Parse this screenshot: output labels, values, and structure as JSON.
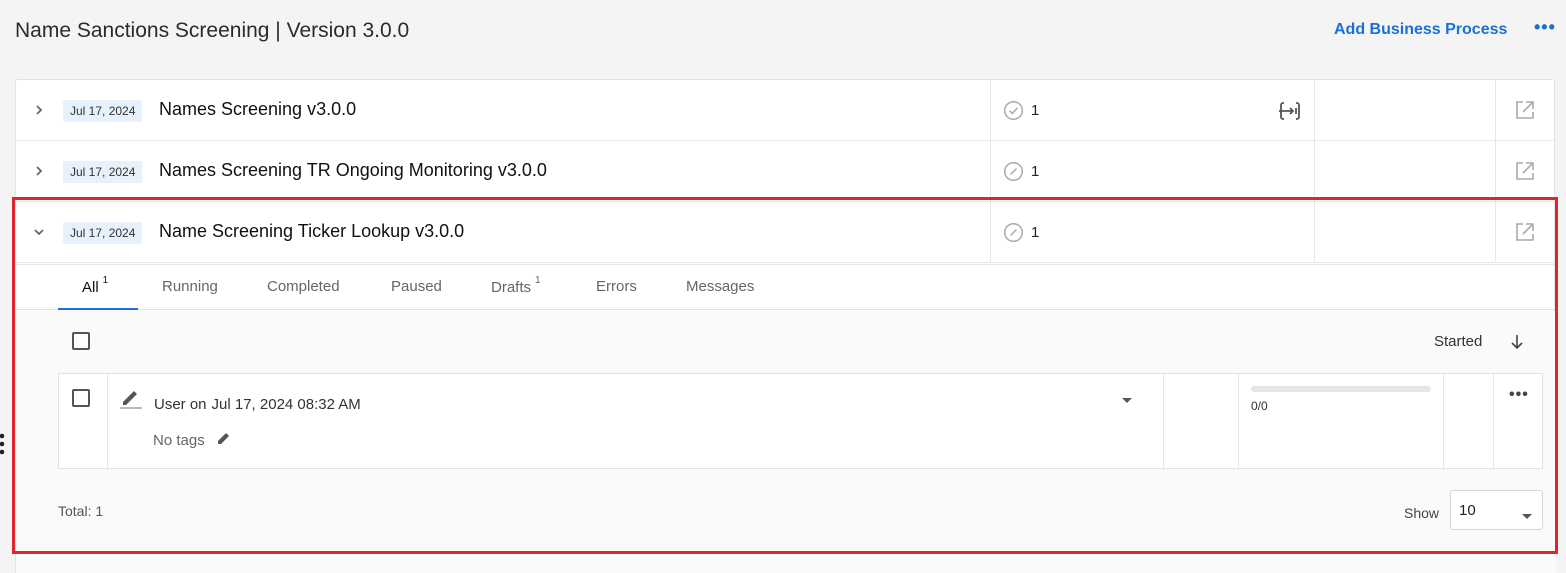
{
  "header": {
    "title": "Name Sanctions Screening | Version 3.0.0",
    "add_label": "Add Business Process",
    "more_label": "•••"
  },
  "processes": [
    {
      "date": "Jul 17, 2024",
      "name": "Names Screening v3.0.0",
      "count": "1",
      "expanded": false,
      "status_icon": "check-circle-icon",
      "has_transfer": true
    },
    {
      "date": "Jul 17, 2024",
      "name": "Names Screening TR Ongoing Monitoring v3.0.0",
      "count": "1",
      "expanded": false,
      "status_icon": "slash-circle-icon",
      "has_transfer": false
    },
    {
      "date": "Jul 17, 2024",
      "name": "Name Screening Ticker Lookup v3.0.0",
      "count": "1",
      "expanded": true,
      "status_icon": "slash-circle-icon",
      "has_transfer": false
    }
  ],
  "tabs": [
    {
      "label": "All",
      "badge": "1",
      "active": true
    },
    {
      "label": "Running",
      "badge": ""
    },
    {
      "label": "Completed",
      "badge": ""
    },
    {
      "label": "Paused",
      "badge": ""
    },
    {
      "label": "Drafts",
      "badge": "1"
    },
    {
      "label": "Errors",
      "badge": ""
    },
    {
      "label": "Messages",
      "badge": ""
    }
  ],
  "list": {
    "sort_label": "Started",
    "instance": {
      "by": "User on",
      "when": "Jul 17, 2024 08:32 AM",
      "tags": "No tags",
      "progress_text": "0/0",
      "progress": 0,
      "more_label": "•••"
    },
    "total": "Total: 1",
    "show_label": "Show",
    "page_size": "10"
  },
  "colors": {
    "accent": "#1a6fd8",
    "highlight": "#e0252b",
    "date_badge_bg": "#e6f1fb"
  }
}
